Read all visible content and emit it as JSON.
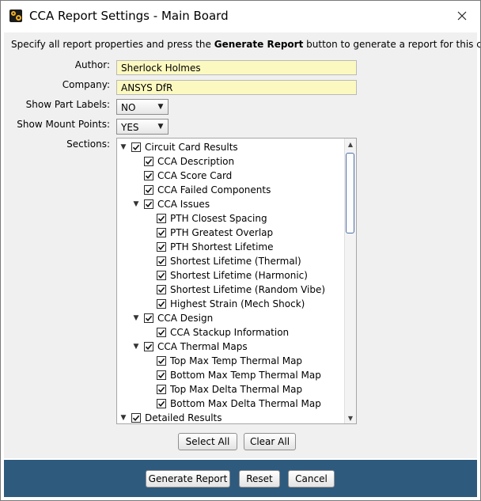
{
  "window": {
    "title": "CCA Report Settings - Main Board"
  },
  "instructions": {
    "prefix": "Specify all report properties and press the ",
    "emphasis": "Generate Report",
    "suffix": " button to generate a report for this circuit card."
  },
  "form": {
    "author_label": "Author:",
    "author_value": "Sherlock Holmes",
    "company_label": "Company:",
    "company_value": "ANSYS DfR",
    "part_labels_label": "Show Part Labels:",
    "part_labels_value": "NO",
    "mount_points_label": "Show Mount Points:",
    "mount_points_value": "YES",
    "sections_label": "Sections:"
  },
  "sections": {
    "items": [
      {
        "label": "Circuit Card Results",
        "level": 0,
        "expanded": true,
        "checked": true
      },
      {
        "label": "CCA Description",
        "level": 1,
        "checked": true
      },
      {
        "label": "CCA Score Card",
        "level": 1,
        "checked": true
      },
      {
        "label": "CCA Failed Components",
        "level": 1,
        "checked": true
      },
      {
        "label": "CCA Issues",
        "level": 1,
        "expanded": true,
        "checked": true
      },
      {
        "label": "PTH Closest Spacing",
        "level": 2,
        "checked": true
      },
      {
        "label": "PTH Greatest Overlap",
        "level": 2,
        "checked": true
      },
      {
        "label": "PTH Shortest Lifetime",
        "level": 2,
        "checked": true
      },
      {
        "label": "Shortest Lifetime (Thermal)",
        "level": 2,
        "checked": true
      },
      {
        "label": "Shortest Lifetime (Harmonic)",
        "level": 2,
        "checked": true
      },
      {
        "label": "Shortest Lifetime (Random Vibe)",
        "level": 2,
        "checked": true
      },
      {
        "label": "Highest Strain (Mech Shock)",
        "level": 2,
        "checked": true
      },
      {
        "label": "CCA Design",
        "level": 1,
        "expanded": true,
        "checked": true
      },
      {
        "label": "CCA Stackup Information",
        "level": 2,
        "checked": true
      },
      {
        "label": "CCA Thermal Maps",
        "level": 1,
        "expanded": true,
        "checked": true
      },
      {
        "label": "Top Max Temp Thermal Map",
        "level": 2,
        "checked": true
      },
      {
        "label": "Bottom Max Temp Thermal Map",
        "level": 2,
        "checked": true
      },
      {
        "label": "Top Max Delta Thermal Map",
        "level": 2,
        "checked": true
      },
      {
        "label": "Bottom Max Delta Thermal Map",
        "level": 2,
        "checked": true
      },
      {
        "label": "Detailed Results",
        "level": 0,
        "expanded": true,
        "checked": true
      }
    ]
  },
  "buttons": {
    "select_all": "Select All",
    "clear_all": "Clear All",
    "generate_report": "Generate Report",
    "reset": "Reset",
    "cancel": "Cancel"
  },
  "icons": {
    "app": "app-logo-icon",
    "close": "close-icon",
    "expanded": "triangle-down-icon",
    "checkbox": "checkmark-icon",
    "dropdown": "triangle-down-icon"
  },
  "colors": {
    "field_bg": "#fcf9c0",
    "footer_bg": "#2e5a7e",
    "content_bg": "#f0f0f0"
  }
}
